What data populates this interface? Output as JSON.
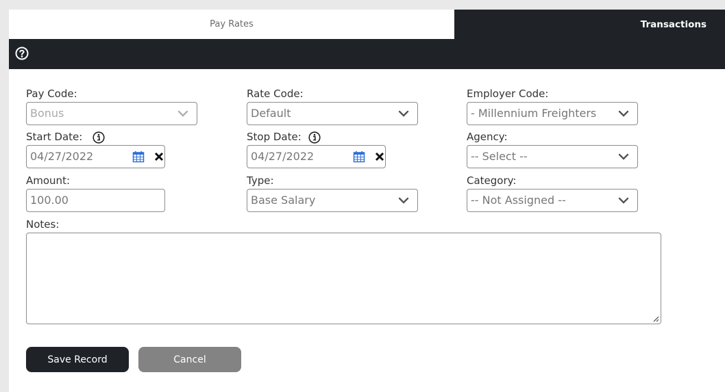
{
  "tabs": {
    "pay_rates": "Pay Rates",
    "transactions": "Transactions"
  },
  "toolbar": {
    "help_icon": "question-circle-icon"
  },
  "form": {
    "pay_code": {
      "label": "Pay Code:",
      "value": "Bonus"
    },
    "rate_code": {
      "label": "Rate Code:",
      "value": "Default"
    },
    "employer_code": {
      "label": "Employer Code:",
      "value": "- Millennium Freighters"
    },
    "start_date": {
      "label": "Start Date:",
      "value": "04/27/2022"
    },
    "stop_date": {
      "label": "Stop Date:",
      "value": "04/27/2022"
    },
    "agency": {
      "label": "Agency:",
      "value": "-- Select --"
    },
    "amount": {
      "label": "Amount:",
      "value": "100.00"
    },
    "type": {
      "label": "Type:",
      "value": "Base Salary"
    },
    "category": {
      "label": "Category:",
      "value": "-- Not Assigned --"
    },
    "notes": {
      "label": "Notes:",
      "value": ""
    }
  },
  "buttons": {
    "save": "Save Record",
    "cancel": "Cancel"
  },
  "colors": {
    "dark": "#1f2328",
    "calendar_blue": "#2f6fd6",
    "cancel_gray": "#838383"
  }
}
